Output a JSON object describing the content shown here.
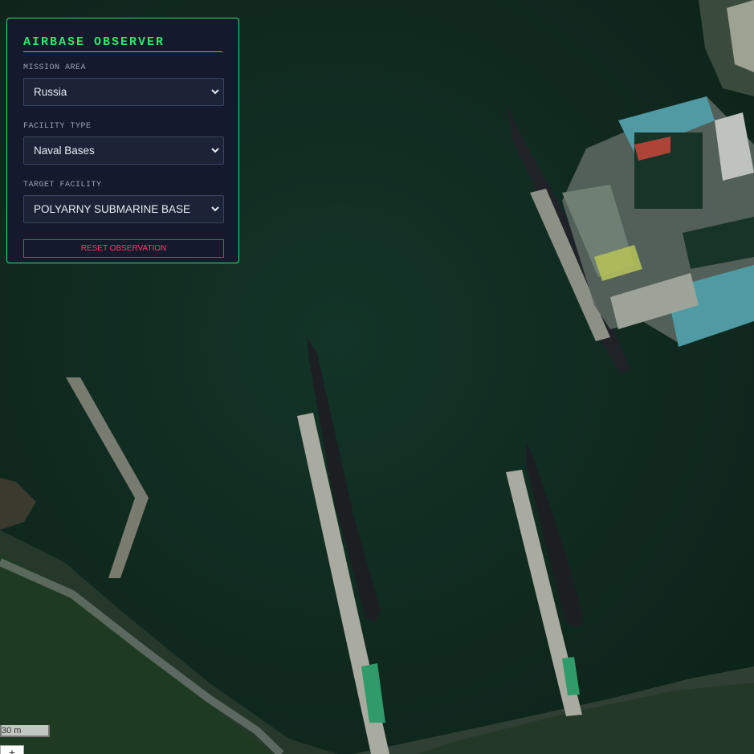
{
  "panel": {
    "title": "AIRBASE OBSERVER",
    "mission_area_label": "MISSION AREA",
    "mission_area_value": "Russia",
    "facility_type_label": "FACILITY TYPE",
    "facility_type_value": "Naval Bases",
    "target_facility_label": "TARGET FACILITY",
    "target_facility_value": "POLYARNY SUBMARINE BASE",
    "reset_label": "RESET OBSERVATION"
  },
  "map": {
    "scale_label": "30 m",
    "zoom_in_label": "+"
  },
  "colors": {
    "accent_green": "#2ee66b",
    "reset_red": "#ff3b6b",
    "panel_bg": "#141a2c"
  }
}
